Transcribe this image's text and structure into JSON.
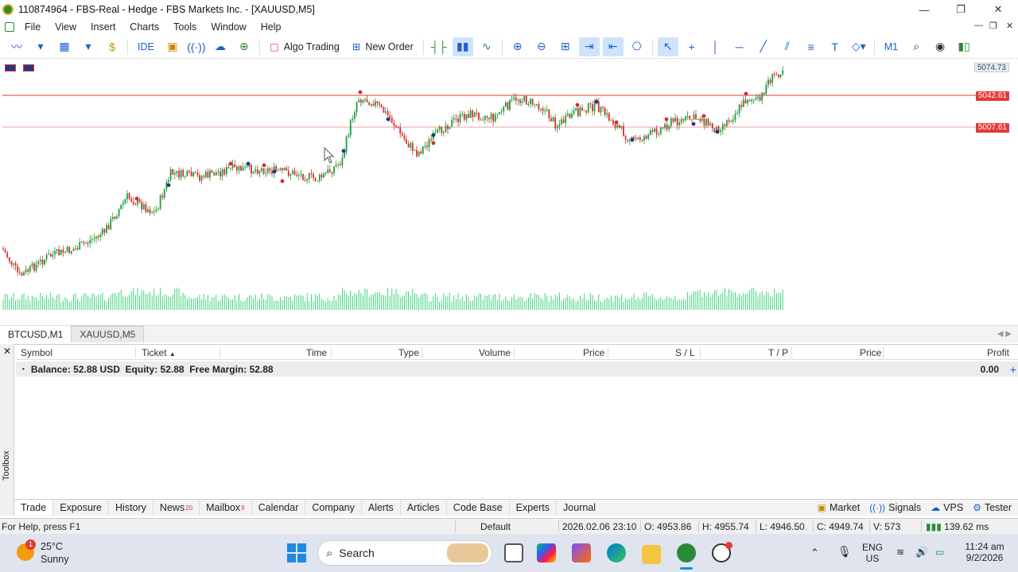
{
  "window": {
    "title": "110874964 - FBS-Real - Hedge - FBS Markets Inc. - [XAUUSD,M5]",
    "controls": [
      "—",
      "❐",
      "✕"
    ]
  },
  "menu": [
    "File",
    "View",
    "Insert",
    "Charts",
    "Tools",
    "Window",
    "Help"
  ],
  "toolbar": {
    "ide_label": "IDE",
    "algo_trading_label": "Algo Trading",
    "new_order_label": "New Order",
    "timeframe_label": "M1"
  },
  "chart": {
    "symbol": "XAUUSD",
    "timeframe": "M5",
    "price_labels": [
      {
        "value": "5074.73",
        "kind": "current",
        "color": "#6a7a8a"
      },
      {
        "value": "5042.61",
        "kind": "line",
        "color": "#e53935"
      },
      {
        "value": "5007.61",
        "kind": "line",
        "color": "#e53935"
      }
    ],
    "colors": {
      "bull": "#1a9e3a",
      "bear": "#d32f2f",
      "volume": "#2ecc71",
      "hline": "#e53935"
    }
  },
  "chart_tabs": [
    {
      "label": "BTCUSD,M1",
      "active": true
    },
    {
      "label": "XAUUSD,M5",
      "active": false
    }
  ],
  "toolbox": {
    "vertical_label": "Toolbox",
    "columns": [
      "Symbol",
      "Ticket",
      "Time",
      "Type",
      "Volume",
      "Price",
      "S / L",
      "T / P",
      "Price",
      "Profit"
    ],
    "balance_text": "Balance: 52.88 USD  Equity: 52.88  Free Margin: 52.88",
    "profit_value": "0.00",
    "tabs": [
      {
        "label": "Trade",
        "badge": ""
      },
      {
        "label": "Exposure",
        "badge": ""
      },
      {
        "label": "History",
        "badge": ""
      },
      {
        "label": "News",
        "badge": "20"
      },
      {
        "label": "Mailbox",
        "badge": "9"
      },
      {
        "label": "Calendar",
        "badge": ""
      },
      {
        "label": "Company",
        "badge": ""
      },
      {
        "label": "Alerts",
        "badge": ""
      },
      {
        "label": "Articles",
        "badge": ""
      },
      {
        "label": "Code Base",
        "badge": ""
      },
      {
        "label": "Experts",
        "badge": ""
      },
      {
        "label": "Journal",
        "badge": ""
      }
    ],
    "right_links": [
      "Market",
      "Signals",
      "VPS",
      "Tester"
    ]
  },
  "status": {
    "help": "For Help, press F1",
    "profile": "Default",
    "datetime": "2026.02.06 23:10",
    "open": "O: 4953.86",
    "high": "H: 4955.74",
    "low": "L: 4946.50",
    "close": "C: 4949.74",
    "volume": "V: 573",
    "ping": "139.62 ms"
  },
  "taskbar": {
    "weather_temp": "25°C",
    "weather_desc": "Sunny",
    "weather_badge": "1",
    "search_placeholder": "Search",
    "lang_top": "ENG",
    "lang_bottom": "US",
    "time": "11:24 am",
    "date": "9/2/2026"
  }
}
